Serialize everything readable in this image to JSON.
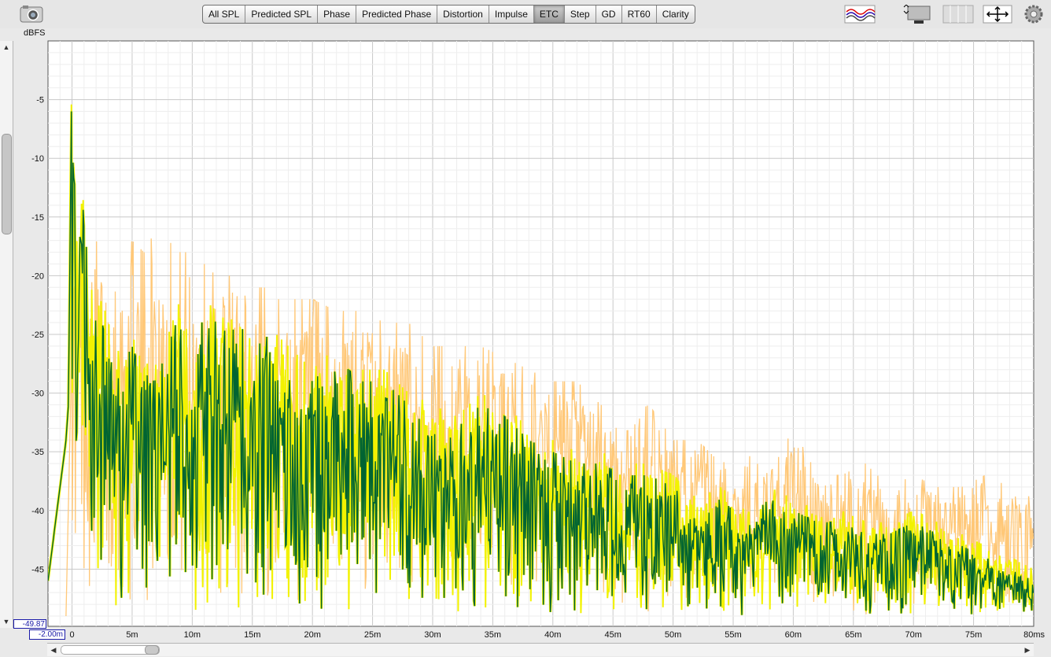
{
  "toolbar": {
    "tabs": [
      {
        "label": "All SPL",
        "active": false
      },
      {
        "label": "Predicted SPL",
        "active": false
      },
      {
        "label": "Phase",
        "active": false
      },
      {
        "label": "Predicted Phase",
        "active": false
      },
      {
        "label": "Distortion",
        "active": false
      },
      {
        "label": "Impulse",
        "active": false
      },
      {
        "label": "ETC",
        "active": true
      },
      {
        "label": "Step",
        "active": false
      },
      {
        "label": "GD",
        "active": false
      },
      {
        "label": "RT60",
        "active": false
      },
      {
        "label": "Clarity",
        "active": false
      }
    ],
    "icons": [
      "camera-icon",
      "waveform-icon",
      "layout-icon",
      "grid-icon",
      "move-icon",
      "gear-icon"
    ]
  },
  "axis": {
    "y_unit": "dBFS",
    "y_min_value": "-49.87",
    "x_min_value": "-2.00m"
  },
  "chart_data": {
    "type": "line",
    "ylabel": "dBFS",
    "xlabel": "",
    "xlim": [
      -2,
      80
    ],
    "ylim": [
      -49.87,
      0
    ],
    "x_ticks": [
      "0",
      "5m",
      "10m",
      "15m",
      "20m",
      "25m",
      "30m",
      "35m",
      "40m",
      "45m",
      "50m",
      "55m",
      "60m",
      "65m",
      "70m",
      "75m",
      "80ms"
    ],
    "x_tick_values": [
      0,
      5,
      10,
      15,
      20,
      25,
      30,
      35,
      40,
      45,
      50,
      55,
      60,
      65,
      70,
      75,
      80
    ],
    "y_ticks": [
      "-5",
      "-10",
      "-15",
      "-20",
      "-25",
      "-30",
      "-35",
      "-40",
      "-45"
    ],
    "y_tick_values": [
      -5,
      -10,
      -15,
      -20,
      -25,
      -30,
      -35,
      -40,
      -45
    ],
    "grid": true,
    "series": [
      {
        "color": "#ffc878",
        "x": [
          -0.5,
          -0.1,
          0.0,
          0.1,
          0.3,
          0.5,
          0.8,
          1.0,
          1.3,
          1.6,
          2.0,
          2.5,
          3.0,
          3.5,
          4.0,
          5.0,
          6.0,
          7.0,
          8.0,
          9.0,
          10.0,
          11.0,
          12.0,
          13.0,
          14.0,
          15.0,
          16.0,
          17.0,
          18.0,
          20.0,
          22.0,
          24.0,
          26.0,
          28.0,
          30.0,
          32.0,
          34.0,
          36.0,
          38.0,
          40.0,
          42.0,
          44.0,
          46.0,
          48.0,
          50.0,
          52.0,
          54.0,
          56.0,
          58.0,
          60.0,
          62.0,
          64.0,
          66.0,
          68.0,
          70.0,
          72.0,
          74.0,
          76.0,
          78.0,
          80.0
        ],
        "peaks": [
          -49,
          -30,
          -1,
          -20,
          -15,
          -14,
          -16,
          -18,
          -19,
          -21,
          -17,
          -18,
          -19,
          -18,
          -19,
          -17,
          -18,
          -16,
          -17,
          -18,
          -18,
          -19,
          -20,
          -20,
          -20,
          -21,
          -21,
          -22,
          -22,
          -22,
          -23,
          -23,
          -24,
          -24,
          -26,
          -26,
          -26,
          -27,
          -28,
          -29,
          -29,
          -31,
          -32,
          -31,
          -34,
          -34,
          -36,
          -35,
          -37,
          -33,
          -37,
          -37,
          -36,
          -38,
          -37,
          -38,
          -38,
          -37,
          -38,
          -39
        ],
        "troughs": [
          -49,
          -49,
          -40,
          -45,
          -48,
          -49,
          -49,
          -46,
          -48,
          -49,
          -49,
          -49,
          -49,
          -48,
          -49,
          -49,
          -49,
          -49,
          -49,
          -49,
          -49,
          -49,
          -49,
          -49,
          -49,
          -49,
          -49,
          -49,
          -49,
          -49,
          -49,
          -49,
          -49,
          -49,
          -49,
          -49,
          -49,
          -49,
          -49,
          -49,
          -49,
          -49,
          -49,
          -49,
          -49,
          -49,
          -49,
          -49,
          -49,
          -49,
          -49,
          -49,
          -49,
          -49,
          -49,
          -49,
          -49,
          -49,
          -49,
          -49
        ]
      },
      {
        "color": "#f2f200",
        "x": [
          -2.0,
          -1.5,
          -1.0,
          -0.5,
          -0.3,
          0.0,
          0.3,
          0.5,
          1.0,
          1.3,
          1.6,
          2.0,
          2.5,
          3.0,
          3.5,
          4.0,
          5.0,
          6.0,
          7.0,
          8.0,
          9.0,
          10.0,
          11.0,
          12.0,
          13.0,
          14.0,
          15.0,
          16.0,
          17.0,
          18.0,
          20.0,
          22.0,
          24.0,
          26.0,
          28.0,
          30.0,
          32.0,
          34.0,
          36.0,
          38.0,
          40.0,
          42.0,
          44.0,
          46.0,
          48.0,
          50.0,
          52.0,
          54.0,
          56.0,
          58.0,
          60.0,
          62.0,
          64.0,
          66.0,
          68.0,
          70.0,
          72.0,
          74.0,
          76.0,
          78.0,
          80.0
        ],
        "peaks": [
          -46,
          -42,
          -38,
          -34,
          -31,
          -0.3,
          -16,
          -18,
          -11,
          -20,
          -21,
          -23,
          -22,
          -24,
          -25,
          -27,
          -25,
          -28,
          -26,
          -25,
          -22,
          -27,
          -22,
          -23,
          -24,
          -23,
          -26,
          -24,
          -25,
          -26,
          -28,
          -26,
          -28,
          -28,
          -30,
          -31,
          -32,
          -30,
          -31,
          -33,
          -34,
          -35,
          -35,
          -36,
          -36,
          -37,
          -39,
          -38,
          -40,
          -38,
          -39,
          -40,
          -40,
          -41,
          -41,
          -40,
          -41,
          -42,
          -43,
          -44,
          -45
        ],
        "troughs": [
          -46,
          -42,
          -38,
          -34,
          -31,
          -30,
          -40,
          -41,
          -40,
          -45,
          -44,
          -47,
          -49,
          -44,
          -49,
          -49,
          -48,
          -49,
          -49,
          -49,
          -49,
          -49,
          -49,
          -49,
          -49,
          -49,
          -49,
          -49,
          -49,
          -49,
          -49,
          -49,
          -49,
          -49,
          -49,
          -49,
          -49,
          -49,
          -49,
          -49,
          -49,
          -49,
          -49,
          -49,
          -49,
          -49,
          -49,
          -49,
          -49,
          -49,
          -49,
          -49,
          -49,
          -49,
          -49,
          -49,
          -49,
          -49,
          -49,
          -49,
          -49
        ]
      },
      {
        "color": "#006432",
        "x": [
          -2.0,
          -1.5,
          -1.0,
          -0.5,
          -0.3,
          0.0,
          0.3,
          0.5,
          1.0,
          1.3,
          1.6,
          2.0,
          2.5,
          3.0,
          3.5,
          4.0,
          5.0,
          6.0,
          7.0,
          8.0,
          9.0,
          10.0,
          11.0,
          12.0,
          13.0,
          14.0,
          15.0,
          16.0,
          17.0,
          18.0,
          20.0,
          22.0,
          24.0,
          26.0,
          28.0,
          30.0,
          32.0,
          34.0,
          36.0,
          38.0,
          40.0,
          42.0,
          44.0,
          46.0,
          48.0,
          50.0,
          52.0,
          54.0,
          56.0,
          58.0,
          60.0,
          62.0,
          64.0,
          66.0,
          68.0,
          70.0,
          72.0,
          74.0,
          76.0,
          78.0,
          80.0
        ],
        "peaks": [
          -46,
          -42,
          -38,
          -34,
          -31,
          -1,
          -17,
          -19,
          -12,
          -21,
          -22,
          -24,
          -23,
          -25,
          -26,
          -28,
          -26,
          -29,
          -27,
          -26,
          -23,
          -28,
          -23,
          -24,
          -25,
          -24,
          -27,
          -25,
          -26,
          -27,
          -29,
          -27,
          -29,
          -29,
          -31,
          -32,
          -33,
          -31,
          -32,
          -34,
          -35,
          -36,
          -36,
          -37,
          -37,
          -38,
          -40,
          -39,
          -41,
          -39,
          -40,
          -41,
          -41,
          -42,
          -42,
          -41,
          -42,
          -43,
          -44,
          -45,
          -46
        ],
        "troughs": [
          -46,
          -42,
          -38,
          -34,
          -31,
          -29,
          -39,
          -40,
          -39,
          -44,
          -43,
          -46,
          -48,
          -43,
          -48,
          -49,
          -47,
          -49,
          -49,
          -49,
          -49,
          -49,
          -49,
          -49,
          -49,
          -49,
          -49,
          -49,
          -49,
          -49,
          -49,
          -49,
          -49,
          -49,
          -49,
          -49,
          -49,
          -49,
          -49,
          -49,
          -49,
          -49,
          -49,
          -49,
          -49,
          -49,
          -49,
          -49,
          -49,
          -49,
          -49,
          -49,
          -49,
          -49,
          -49,
          -49,
          -49,
          -49,
          -49,
          -49,
          -49
        ]
      }
    ]
  }
}
